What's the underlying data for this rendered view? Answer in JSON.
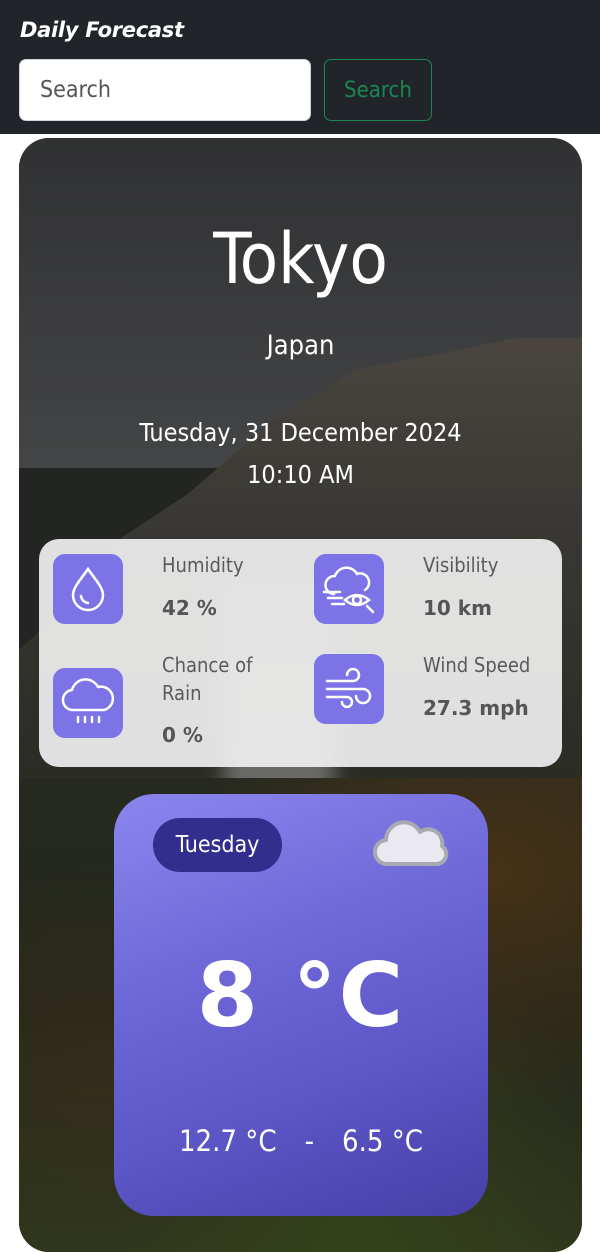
{
  "header": {
    "brand": "Daily Forecast",
    "search_placeholder": "Search",
    "search_button": "Search"
  },
  "location": {
    "city": "Tokyo",
    "country": "Japan",
    "date": "Tuesday, 31 December 2024",
    "time": "10:10 AM"
  },
  "stats": {
    "humidity": {
      "label": "Humidity",
      "value": "42 %",
      "icon": "droplet-icon"
    },
    "visibility": {
      "label": "Visibility",
      "value": "10 km",
      "icon": "cloud-eye-icon"
    },
    "rain": {
      "label": "Chance of Rain",
      "value": "0 %",
      "icon": "rain-cloud-icon"
    },
    "wind": {
      "label": "Wind Speed",
      "value": "27.3 mph",
      "icon": "wind-icon"
    }
  },
  "forecast": {
    "day": "Tuesday",
    "condition_icon": "cloud-icon",
    "temperature": "8 °C",
    "high": "12.7 °C",
    "separator": "-",
    "low": "6.5 °C"
  },
  "colors": {
    "topbar": "#212529",
    "accent_green": "#198754",
    "icon_purple": "#7b73e6",
    "pill_navy": "#312e8e"
  }
}
